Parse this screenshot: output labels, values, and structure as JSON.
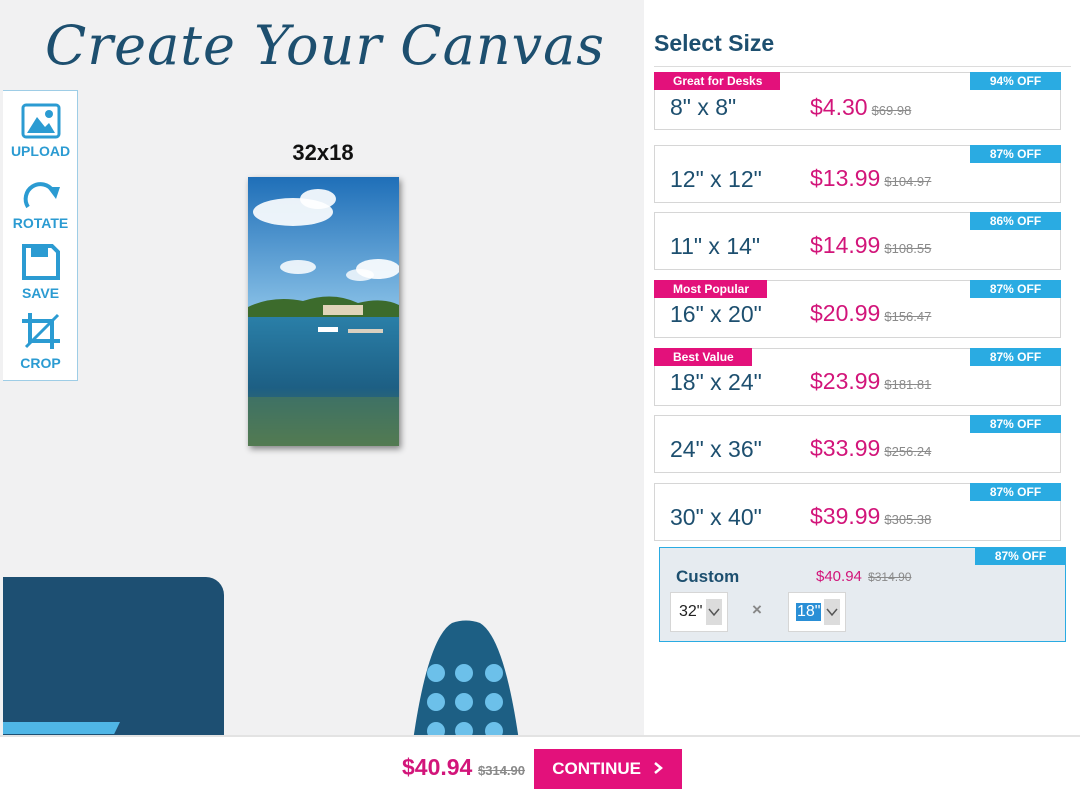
{
  "stage": {
    "title": "Create Your Canvas",
    "size_label": "32x18"
  },
  "toolbar": {
    "items": [
      {
        "label": "UPLOAD",
        "icon": "image-icon"
      },
      {
        "label": "ROTATE",
        "icon": "rotate-icon"
      },
      {
        "label": "SAVE",
        "icon": "save-icon"
      },
      {
        "label": "CROP",
        "icon": "crop-icon"
      }
    ]
  },
  "panel": {
    "title": "Select Size",
    "sizes": [
      {
        "dims": "8\" x 8\"",
        "price": "$4.30",
        "old_price": "$69.98",
        "off": "94% OFF",
        "tag": "Great for Desks"
      },
      {
        "dims": "12\" x 12\"",
        "price": "$13.99",
        "old_price": "$104.97",
        "off": "87% OFF",
        "tag": ""
      },
      {
        "dims": "11\" x 14\"",
        "price": "$14.99",
        "old_price": "$108.55",
        "off": "86% OFF",
        "tag": ""
      },
      {
        "dims": "16\" x 20\"",
        "price": "$20.99",
        "old_price": "$156.47",
        "off": "87% OFF",
        "tag": "Most Popular"
      },
      {
        "dims": "18\" x 24\"",
        "price": "$23.99",
        "old_price": "$181.81",
        "off": "87% OFF",
        "tag": "Best Value"
      },
      {
        "dims": "24\" x 36\"",
        "price": "$33.99",
        "old_price": "$256.24",
        "off": "87% OFF",
        "tag": ""
      },
      {
        "dims": "30\" x 40\"",
        "price": "$39.99",
        "old_price": "$305.38",
        "off": "87% OFF",
        "tag": ""
      }
    ],
    "custom": {
      "label": "Custom",
      "price": "$40.94",
      "old_price": "$314.90",
      "off": "87% OFF",
      "width_value": "32\"",
      "height_value": "18\"",
      "times": "×"
    }
  },
  "footer": {
    "price": "$40.94",
    "old_price": "$314.90",
    "continue_label": "CONTINUE"
  },
  "colors": {
    "brand_navy": "#1d4f6f",
    "accent_blue": "#2aabe2",
    "accent_pink": "#e3117b"
  }
}
